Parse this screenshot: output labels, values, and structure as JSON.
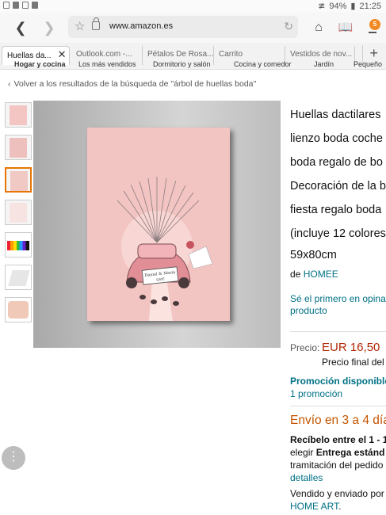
{
  "status": {
    "battery": "94%",
    "time": "21:25"
  },
  "browser": {
    "url": "www.amazon.es",
    "tab_count": "5"
  },
  "tabs": [
    {
      "label": "Huellas da..."
    },
    {
      "label": "Outlook.com -..."
    },
    {
      "label": "Pétalos De Rosa..."
    },
    {
      "label": "Carrito"
    },
    {
      "label": "Vestidos de nov..."
    }
  ],
  "subnav": [
    "Hogar y cocina",
    "Los más vendidos",
    "Dormitorio y salón",
    "Cocina y comedor",
    "Jardín",
    "Pequeño"
  ],
  "breadcrumb": "Volver a los resultados de la búsqueda de \"árbol de huellas boda\"",
  "artwork": {
    "sign_text": "Daniel & Maria",
    "sign_date": "DATE"
  },
  "product": {
    "title_lines": [
      "Huellas dactilares",
      "lienzo boda coche",
      "boda regalo de bo",
      "Decoración de la b",
      "fiesta regalo boda",
      "(incluye 12 colores"
    ],
    "size": "59x80cm",
    "brand_prefix": "de",
    "brand": "HOMEE",
    "review_line1": "Sé el primero en opina",
    "review_line2": "producto",
    "price_label": "Precio:",
    "price": "EUR 16,50",
    "price_final": "Precio final del",
    "promo_title": "Promoción disponible",
    "promo_count": "1 promoción",
    "shipping": "Envío en 3 a 4 día",
    "recv_line1": "Recíbelo entre el 1 - 1",
    "recv_line2_prefix": "elegir",
    "recv_line2_bold": "Entrega estánd",
    "recv_line3": "tramitación del pedido",
    "recv_line4": "detalles",
    "recv_line5": "Vendido y enviado por",
    "recv_line6_link": "HOME ART",
    "recv_line6_end": "."
  },
  "colors": {
    "accent": "#e77600",
    "link": "#007185",
    "price": "#b12704",
    "shipping": "#c45500"
  }
}
